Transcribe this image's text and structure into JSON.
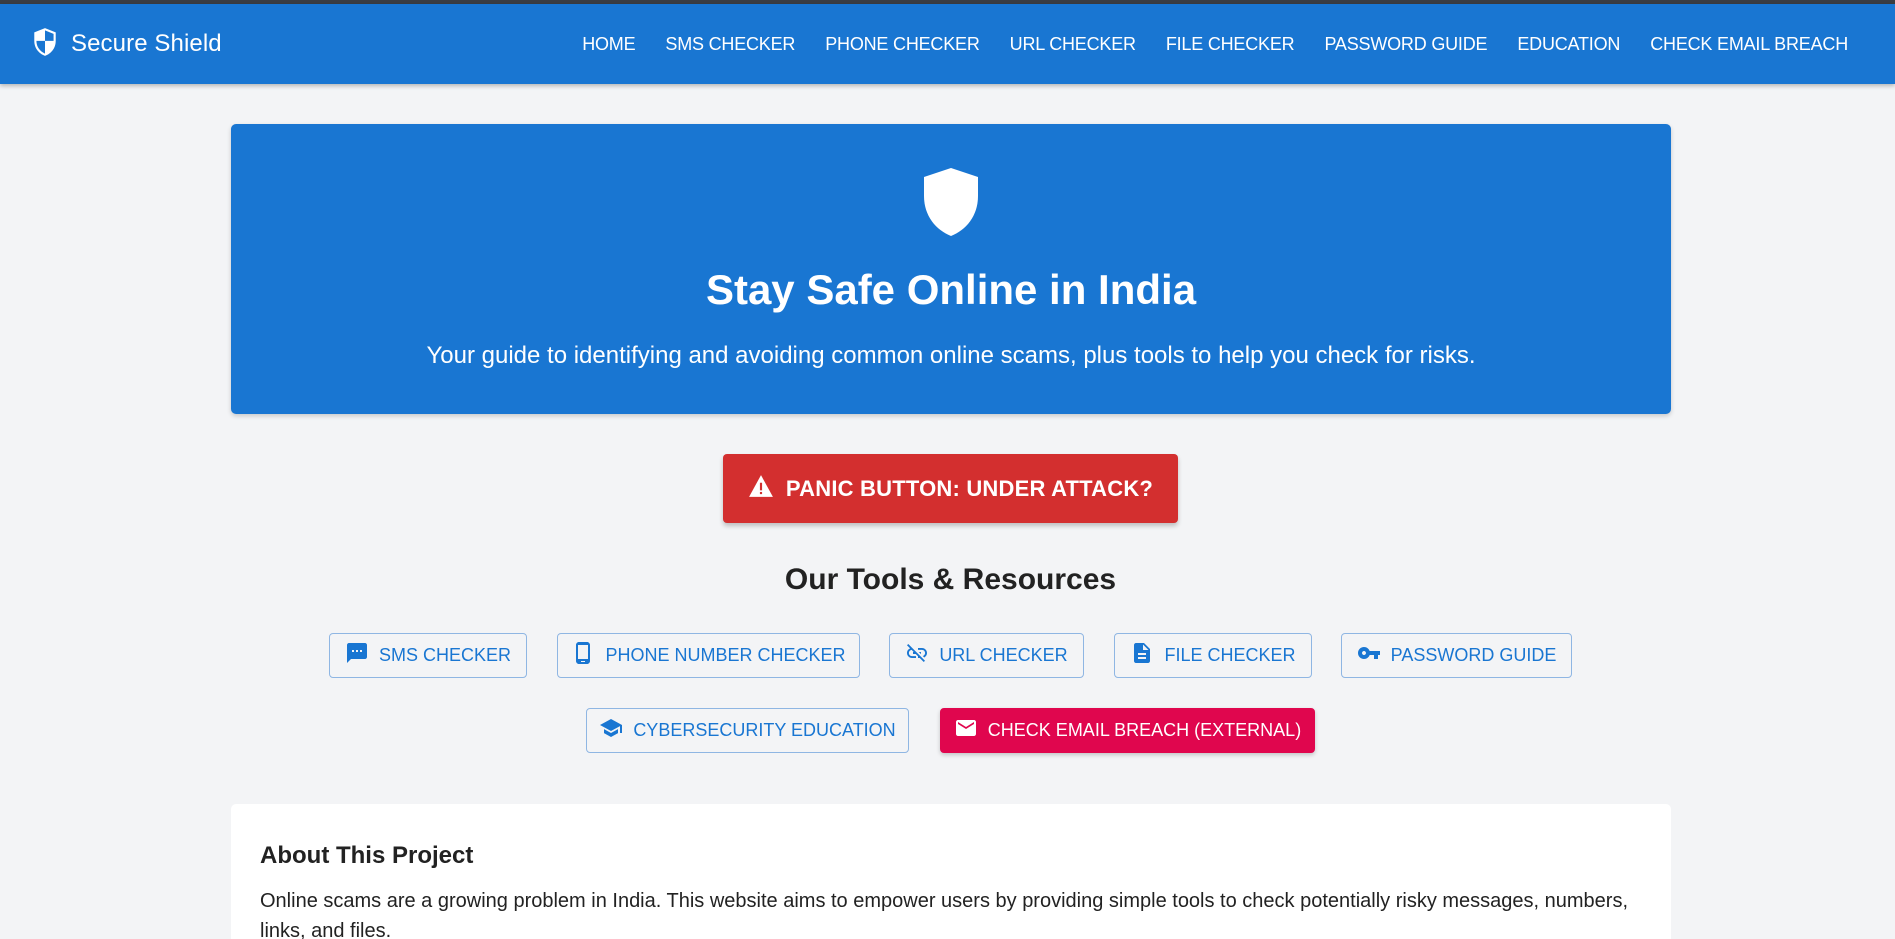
{
  "appbar": {
    "brand_title": "Secure Shield",
    "brand_icon": "shield-half-icon",
    "nav": [
      "HOME",
      "SMS CHECKER",
      "PHONE CHECKER",
      "URL CHECKER",
      "FILE CHECKER",
      "PASSWORD GUIDE",
      "EDUCATION",
      "CHECK EMAIL BREACH"
    ]
  },
  "hero": {
    "icon": "shield-icon",
    "title": "Stay Safe Online in India",
    "subtitle": "Your guide to identifying and avoiding common online scams, plus tools to help you check for risks."
  },
  "panic": {
    "icon": "warning-icon",
    "label": "PANIC BUTTON: UNDER ATTACK?"
  },
  "tools": {
    "title": "Our Tools & Resources",
    "buttons": [
      {
        "label": "SMS CHECKER",
        "icon": "sms-icon"
      },
      {
        "label": "PHONE NUMBER CHECKER",
        "icon": "phone-icon"
      },
      {
        "label": "URL CHECKER",
        "icon": "link-off-icon"
      },
      {
        "label": "FILE CHECKER",
        "icon": "file-icon"
      },
      {
        "label": "PASSWORD GUIDE",
        "icon": "key-icon"
      },
      {
        "label": "CYBERSECURITY EDUCATION",
        "icon": "school-icon"
      },
      {
        "label": "CHECK EMAIL BREACH (EXTERNAL)",
        "icon": "email-icon"
      }
    ]
  },
  "about": {
    "title": "About This Project",
    "text": "Online scams are a growing problem in India. This website aims to empower users by providing simple tools to check potentially risky messages, numbers, links, and files."
  },
  "colors": {
    "primary": "#1976d2",
    "panic": "#d32f2f",
    "external": "#e0064e",
    "background": "#f3f4f6"
  }
}
